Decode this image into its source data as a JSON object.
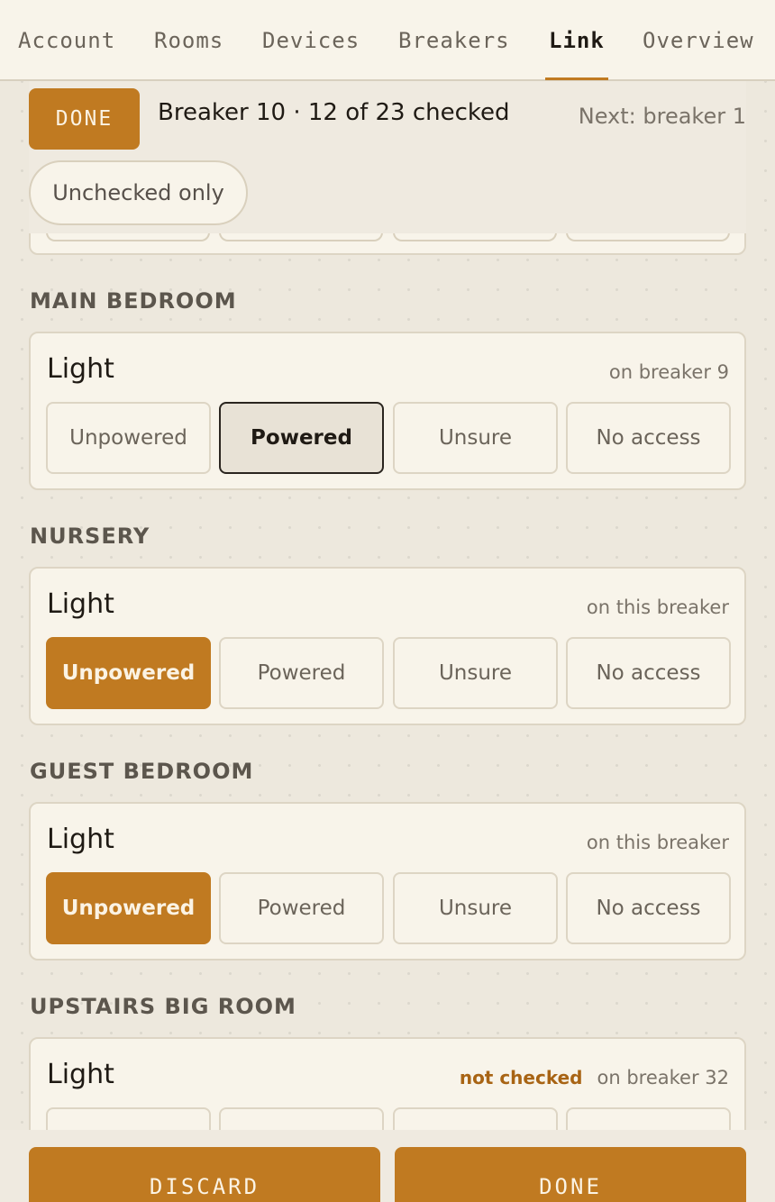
{
  "tabs": [
    {
      "label": "Account"
    },
    {
      "label": "Rooms"
    },
    {
      "label": "Devices"
    },
    {
      "label": "Breakers"
    },
    {
      "label": "Link",
      "active": true
    },
    {
      "label": "Overview"
    }
  ],
  "header": {
    "done_label": "DONE",
    "progress": "Breaker 10 · 12 of 23 checked",
    "next": "Next: breaker 1",
    "filter_chip": "Unchecked only"
  },
  "options": [
    "Unpowered",
    "Powered",
    "Unsure",
    "No access"
  ],
  "rooms": [
    {
      "name": "MAIN BEDROOM",
      "device": "Light",
      "meta": "on breaker 9",
      "selected": "Powered"
    },
    {
      "name": "NURSERY",
      "device": "Light",
      "meta": "on this breaker",
      "selected": "Unpowered"
    },
    {
      "name": "GUEST BEDROOM",
      "device": "Light",
      "meta": "on this breaker",
      "selected": "Unpowered"
    },
    {
      "name": "UPSTAIRS BIG ROOM",
      "device": "Light",
      "status": "not checked",
      "meta": "on breaker 32",
      "selected": null
    }
  ],
  "footer": {
    "discard_label": "DISCARD",
    "done_label": "DONE"
  },
  "colors": {
    "accent": "#c07a21",
    "background": "#ede8dd",
    "card": "#f8f4ea"
  }
}
